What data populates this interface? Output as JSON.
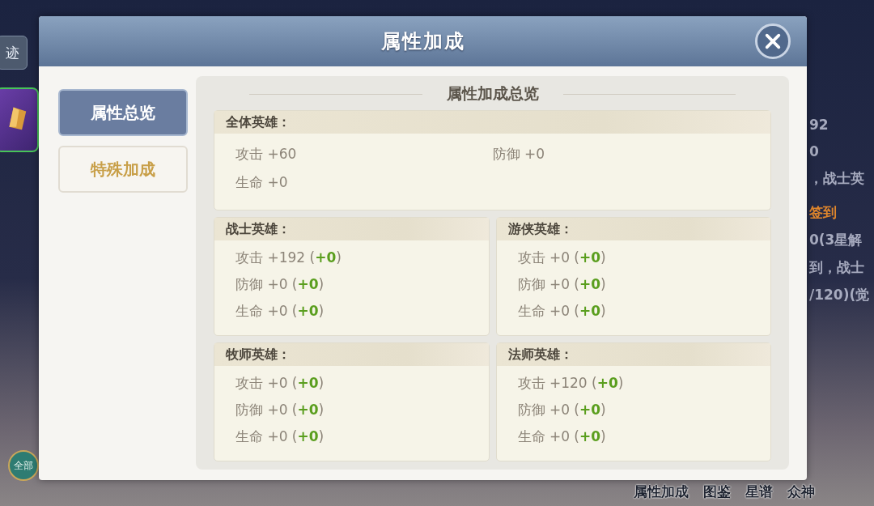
{
  "background": {
    "side_button": "迹",
    "all_button": "全部",
    "right_text": [
      {
        "text": "92",
        "kind": "plain"
      },
      {
        "text": "0",
        "kind": "plain"
      },
      {
        "text": "，战士英",
        "kind": "plain"
      },
      {
        "text": "签到",
        "kind": "accent"
      },
      {
        "text": "0(3星解",
        "kind": "plain"
      },
      {
        "text": "到，战士",
        "kind": "plain"
      },
      {
        "text": "/120)(觉",
        "kind": "plain"
      }
    ],
    "bottom_nav": [
      {
        "label": "属性加成"
      },
      {
        "label": "图鉴"
      },
      {
        "label": "星谱"
      },
      {
        "label": "众神"
      }
    ]
  },
  "dialog": {
    "title": "属性加成",
    "tabs": [
      {
        "label": "属性总览",
        "selected": true
      },
      {
        "label": "特殊加成",
        "selected": false
      }
    ],
    "panel_title": "属性加成总览",
    "groups": [
      {
        "title": "全体英雄：",
        "kind": "wide",
        "stats": [
          {
            "text": "攻击 +60"
          },
          {
            "text": "防御 +0"
          },
          {
            "text": "生命 +0"
          }
        ]
      },
      {
        "title": "战士英雄：",
        "kind": "half",
        "stats": [
          {
            "text": "攻击 +192 (",
            "bonus": "+0",
            "close": ")"
          },
          {
            "text": "防御 +0 (",
            "bonus": "+0",
            "close": ")"
          },
          {
            "text": "生命 +0 (",
            "bonus": "+0",
            "close": ")"
          }
        ]
      },
      {
        "title": "游侠英雄：",
        "kind": "half",
        "stats": [
          {
            "text": "攻击 +0 (",
            "bonus": "+0",
            "close": ")"
          },
          {
            "text": "防御 +0 (",
            "bonus": "+0",
            "close": ")"
          },
          {
            "text": "生命 +0 (",
            "bonus": "+0",
            "close": ")"
          }
        ]
      },
      {
        "title": "牧师英雄：",
        "kind": "half",
        "stats": [
          {
            "text": "攻击 +0 (",
            "bonus": "+0",
            "close": ")"
          },
          {
            "text": "防御 +0 (",
            "bonus": "+0",
            "close": ")"
          },
          {
            "text": "生命 +0 (",
            "bonus": "+0",
            "close": ")"
          }
        ]
      },
      {
        "title": "法师英雄：",
        "kind": "half",
        "stats": [
          {
            "text": "攻击 +120 (",
            "bonus": "+0",
            "close": ")"
          },
          {
            "text": "防御 +0 (",
            "bonus": "+0",
            "close": ")"
          },
          {
            "text": "生命 +0 (",
            "bonus": "+0",
            "close": ")"
          }
        ]
      }
    ]
  }
}
